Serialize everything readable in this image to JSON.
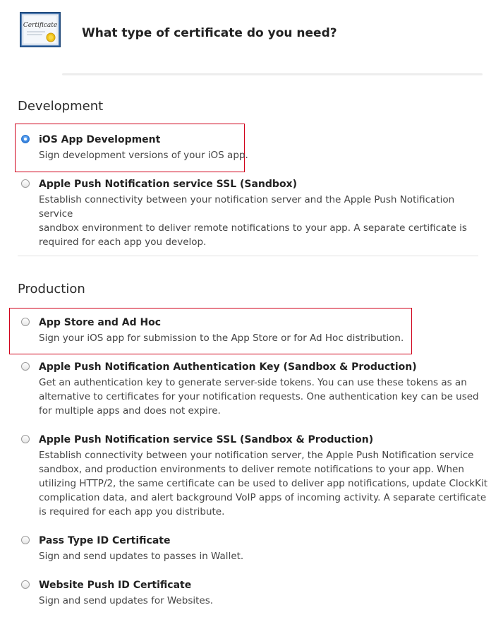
{
  "header": {
    "icon": "certificate-icon",
    "icon_text": "Certificate",
    "title": "What type of certificate do you need?"
  },
  "sections": {
    "development": {
      "title": "Development",
      "options": [
        {
          "title": "iOS App Development",
          "description": "Sign development versions of your iOS app.",
          "selected": true
        },
        {
          "title": "Apple Push Notification service SSL (Sandbox)",
          "description_lines": [
            "Establish connectivity between your notification server and the Apple Push Notification service",
            "sandbox environment to deliver remote notifications to your app. A separate certificate is",
            "required for each app you develop."
          ],
          "selected": false
        }
      ]
    },
    "production": {
      "title": "Production",
      "options": [
        {
          "title": "App Store and Ad Hoc",
          "description": "Sign your iOS app for submission to the App Store or for Ad Hoc distribution.",
          "selected": false
        },
        {
          "title": "Apple Push Notification Authentication Key (Sandbox & Production)",
          "description_lines": [
            "Get an authentication key to generate server-side tokens. You can use these tokens as an",
            "alternative to certificates for your notification requests. One authentication key can be used",
            "for multiple apps and does not expire."
          ],
          "selected": false
        },
        {
          "title": "Apple Push Notification service SSL (Sandbox & Production)",
          "description_lines": [
            "Establish connectivity between your notification server, the Apple Push Notification service",
            "sandbox, and production environments to deliver remote notifications to your app. When",
            "utilizing HTTP/2, the same certificate can be used to deliver app notifications, update ClockKit",
            "complication data, and alert background VoIP apps of incoming activity. A separate certificate",
            "is required for each app you distribute."
          ],
          "selected": false
        },
        {
          "title": "Pass Type ID Certificate",
          "description": "Sign and send updates to passes in Wallet.",
          "selected": false
        },
        {
          "title": "Website Push ID Certificate",
          "description": "Sign and send updates for Websites.",
          "selected": false
        }
      ]
    }
  },
  "colors": {
    "highlight_border": "#d0021b",
    "radio_selected": "#3f8be4"
  }
}
